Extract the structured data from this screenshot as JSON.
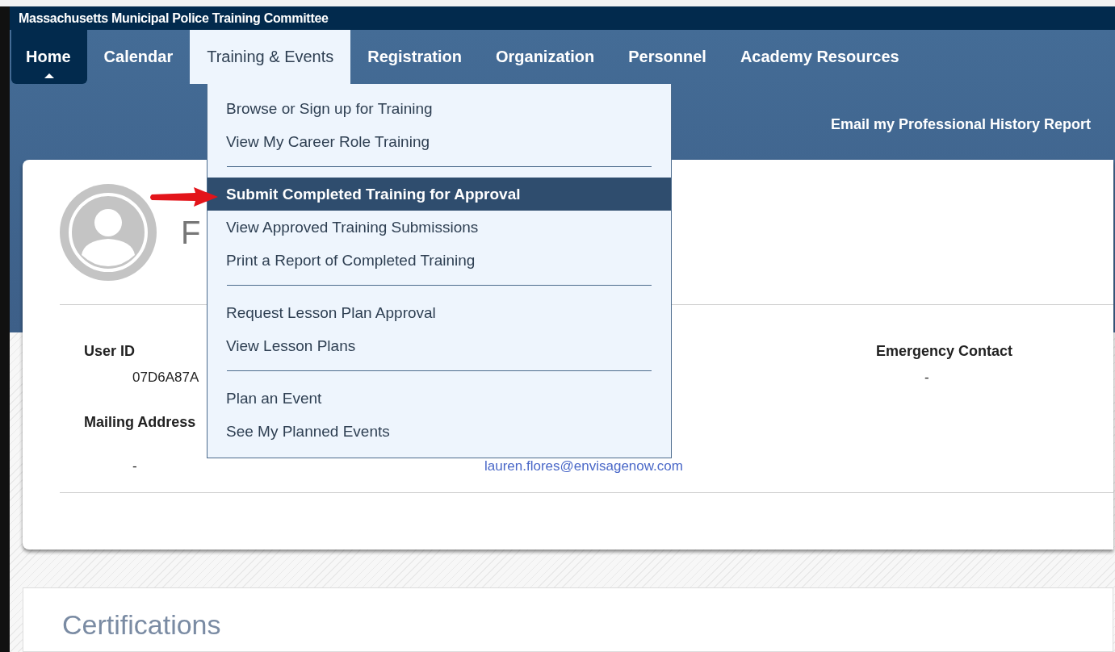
{
  "header": {
    "title": "Massachusetts Municipal Police Training Committee"
  },
  "nav": {
    "tabs": [
      {
        "label": "Home",
        "selected": true,
        "open": false
      },
      {
        "label": "Calendar",
        "selected": false,
        "open": false
      },
      {
        "label": "Training & Events",
        "selected": false,
        "open": true
      },
      {
        "label": "Registration",
        "selected": false,
        "open": false
      },
      {
        "label": "Organization",
        "selected": false,
        "open": false
      },
      {
        "label": "Personnel",
        "selected": false,
        "open": false
      },
      {
        "label": "Academy Resources",
        "selected": false,
        "open": false
      }
    ]
  },
  "dropdown": {
    "groups": [
      {
        "items": [
          {
            "label": "Browse or Sign up for Training",
            "selected": false
          },
          {
            "label": "View My Career Role Training",
            "selected": false
          }
        ]
      },
      {
        "items": [
          {
            "label": "Submit Completed Training for Approval",
            "selected": true
          },
          {
            "label": "View Approved Training Submissions",
            "selected": false
          },
          {
            "label": "Print a Report of Completed Training",
            "selected": false
          }
        ]
      },
      {
        "items": [
          {
            "label": "Request Lesson Plan Approval",
            "selected": false
          },
          {
            "label": "View Lesson Plans",
            "selected": false
          }
        ]
      },
      {
        "items": [
          {
            "label": "Plan an Event",
            "selected": false
          },
          {
            "label": "See My Planned Events",
            "selected": false
          }
        ]
      }
    ]
  },
  "actions": {
    "email_report": "Email my Professional History Report"
  },
  "profile": {
    "name": "F",
    "rows": [
      {
        "cells": [
          {
            "label": "User ID",
            "value": "07D6A87A"
          },
          {},
          {
            "label": "Emergency Contact",
            "value": "-"
          }
        ]
      },
      {
        "cells": [
          {
            "label": "Mailing Address",
            "value": "-"
          },
          {
            "value": "lauren.flores@envisagenow.com",
            "kind": "link"
          },
          {}
        ]
      }
    ]
  },
  "certifications": {
    "title": "Certifications"
  }
}
